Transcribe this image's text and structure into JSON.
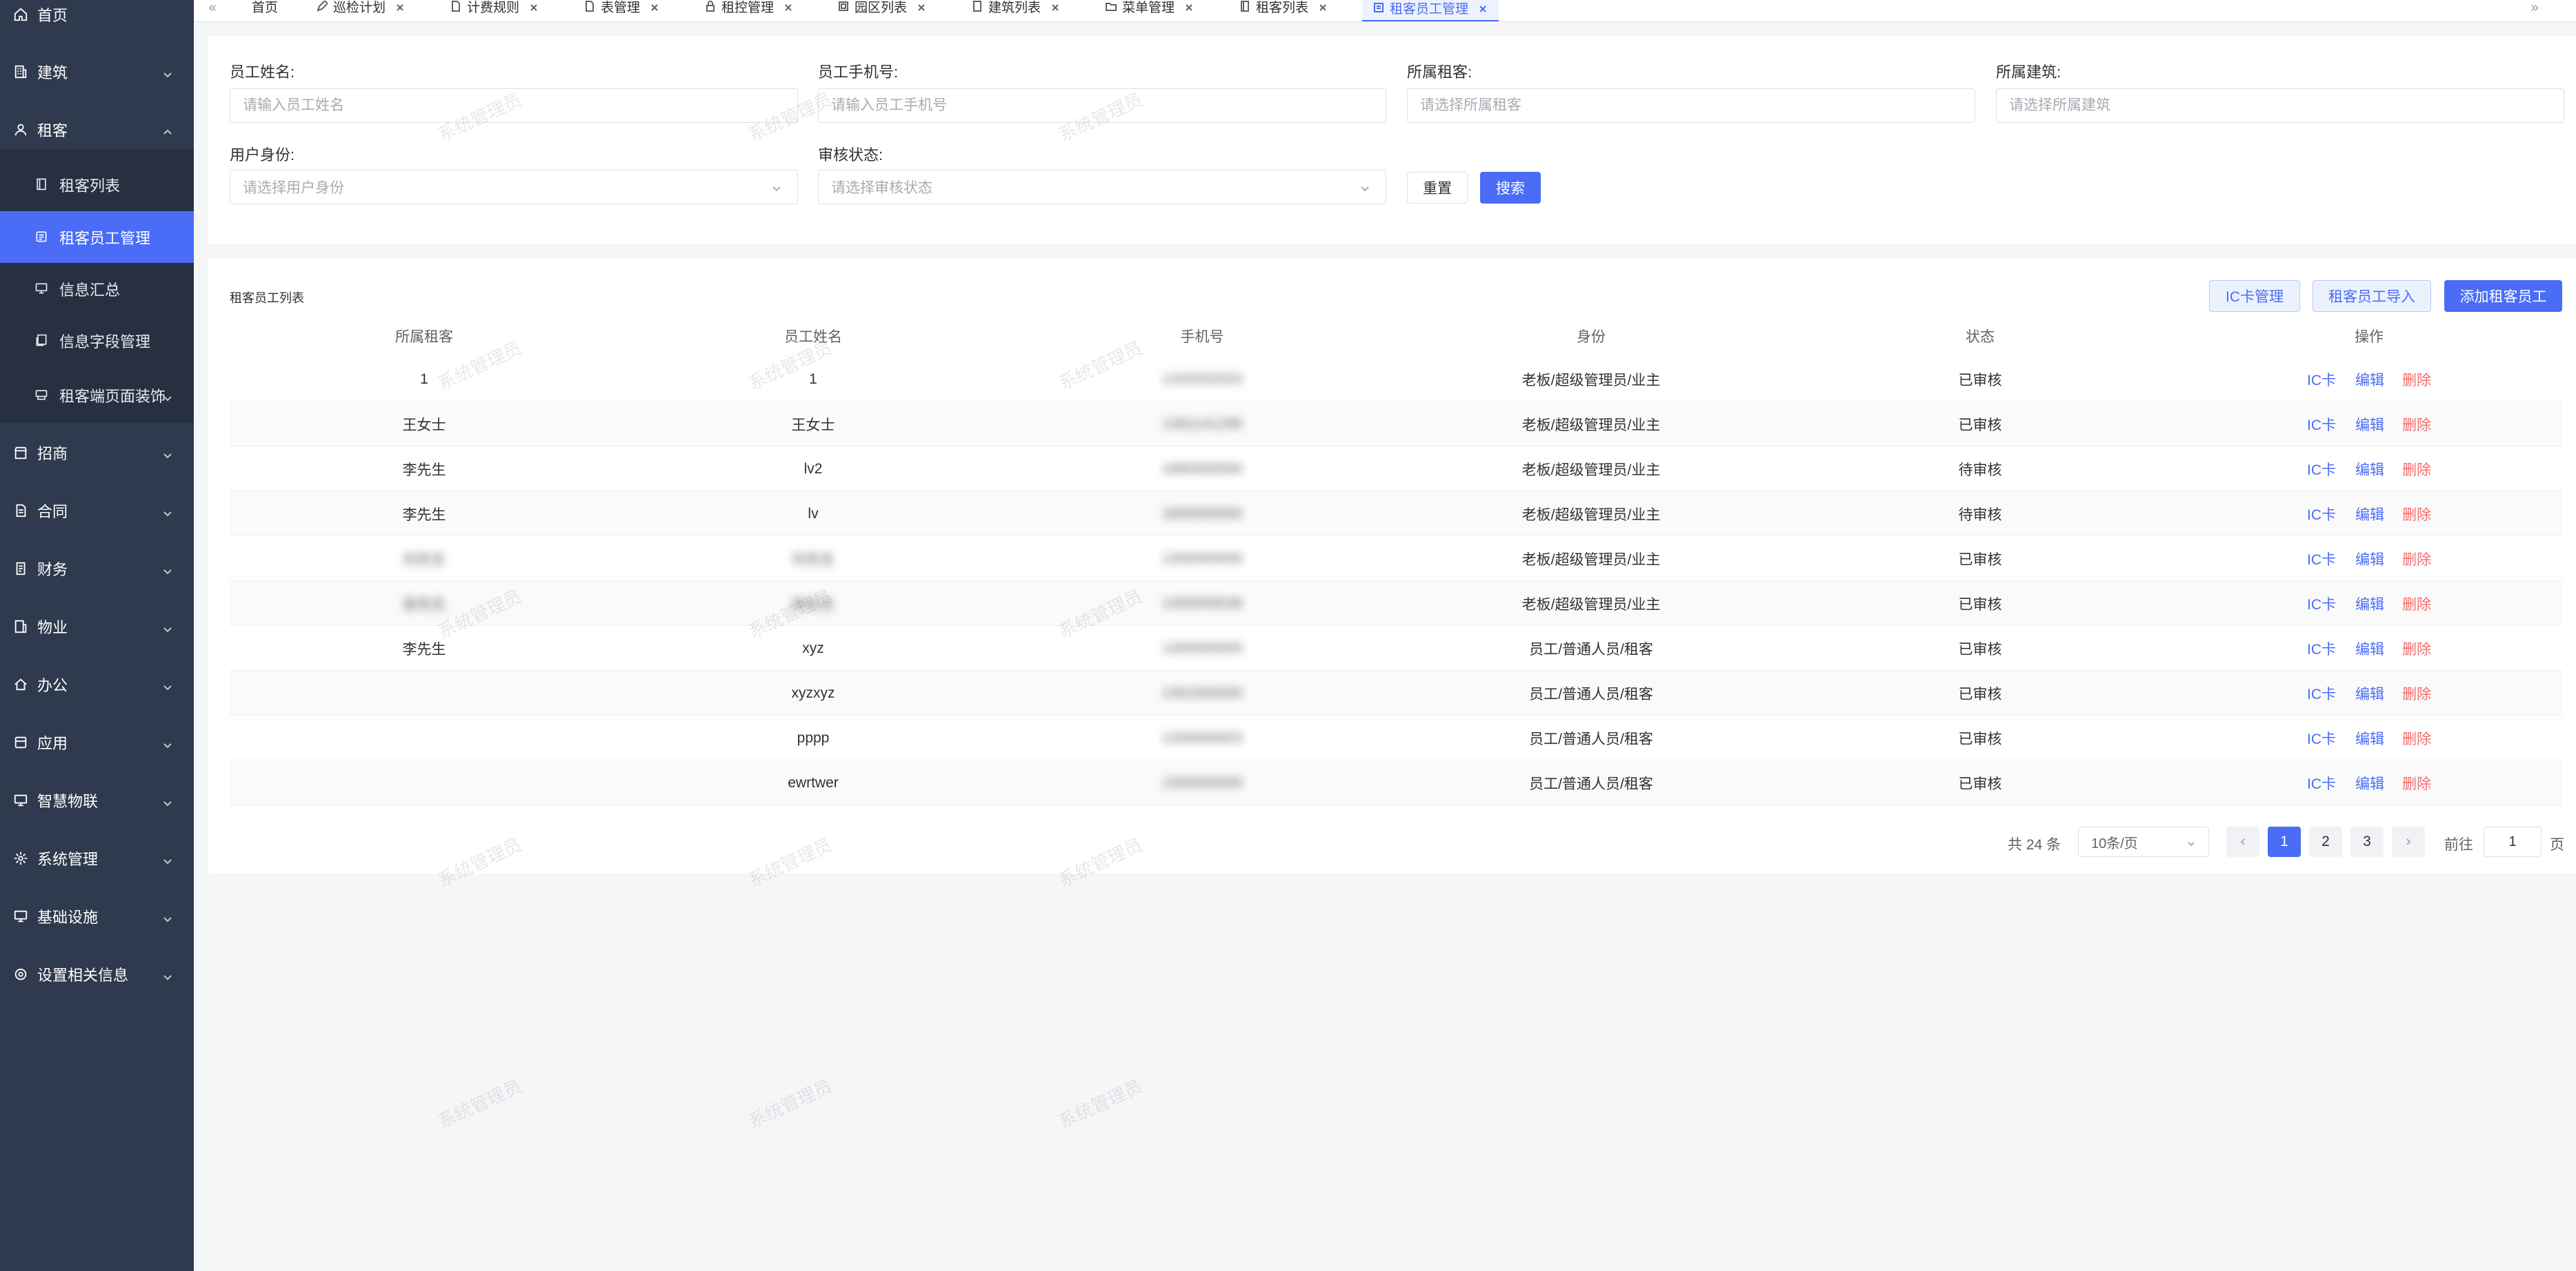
{
  "sidebar": {
    "home": "首页",
    "building": "建筑",
    "tenant": "租客",
    "tenant_sub": [
      "租客列表",
      "租客员工管理",
      "信息汇总",
      "信息字段管理",
      "租客端页面装饰"
    ],
    "sections": [
      "招商",
      "合同",
      "财务",
      "物业",
      "办公",
      "应用",
      "智慧物联",
      "系统管理",
      "基础设施",
      "设置相关信息"
    ]
  },
  "tabs": [
    "首页",
    "巡检计划",
    "计费规则",
    "表管理",
    "租控管理",
    "园区列表",
    "建筑列表",
    "菜单管理",
    "租客列表",
    "租客员工管理"
  ],
  "filters": {
    "name_label": "员工姓名:",
    "name_placeholder": "请输入员工姓名",
    "phone_label": "员工手机号:",
    "phone_placeholder": "请输入员工手机号",
    "tenant_label": "所属租客:",
    "tenant_placeholder": "请选择所属租客",
    "building_label": "所属建筑:",
    "building_placeholder": "请选择所属建筑",
    "identity_label": "用户身份:",
    "identity_placeholder": "请选择用户身份",
    "status_label": "审核状态:",
    "status_placeholder": "请选择审核状态",
    "reset": "重置",
    "search": "搜索"
  },
  "table": {
    "title": "租客员工列表",
    "ic_manage": "IC卡管理",
    "import": "租客员工导入",
    "add": "添加租客员工",
    "columns": [
      "所属租客",
      "员工姓名",
      "手机号",
      "身份",
      "状态",
      "操作"
    ],
    "actions": {
      "ic": "IC卡",
      "edit": "编辑",
      "delete": "删除"
    },
    "rows": [
      {
        "tenant": "1",
        "name": "1",
        "phone": "1333333333",
        "identity": "老板/超级管理员/业主",
        "status": "已审核"
      },
      {
        "tenant": "王女士",
        "name": "王女士",
        "phone": "1361141299",
        "identity": "老板/超级管理员/业主",
        "status": "已审核"
      },
      {
        "tenant": "李先生",
        "name": "lv2",
        "phone": "1880000000",
        "identity": "老板/超级管理员/业主",
        "status": "待审核"
      },
      {
        "tenant": "李先生",
        "name": "lv",
        "phone": "1800000000",
        "identity": "老板/超级管理员/业主",
        "status": "待审核"
      },
      {
        "tenant": "刘先生",
        "name": "刘先生",
        "phone": "1300000000",
        "identity": "老板/超级管理员/业主",
        "status": "已审核"
      },
      {
        "tenant": "张先生",
        "name": "张先生",
        "phone": "1300000038",
        "identity": "老板/超级管理员/业主",
        "status": "已审核"
      },
      {
        "tenant": "李先生",
        "name": "xyz",
        "phone": "1300000000",
        "identity": "员工/普通人员/租客",
        "status": "已审核"
      },
      {
        "tenant": "",
        "name": "xyzxyz",
        "phone": "1301500000",
        "identity": "员工/普通人员/租客",
        "status": "已审核"
      },
      {
        "tenant": "",
        "name": "pppp",
        "phone": "1300000003",
        "identity": "员工/普通人员/租客",
        "status": "已审核"
      },
      {
        "tenant": "",
        "name": "ewrtwer",
        "phone": "1300000000",
        "identity": "员工/普通人员/租客",
        "status": "已审核"
      }
    ]
  },
  "pagination": {
    "total": "共 24 条",
    "page_size": "10条/页",
    "pages": [
      "1",
      "2",
      "3"
    ],
    "goto": "前往",
    "goto_value": "1",
    "page_unit": "页"
  },
  "watermark": "系统管理员"
}
